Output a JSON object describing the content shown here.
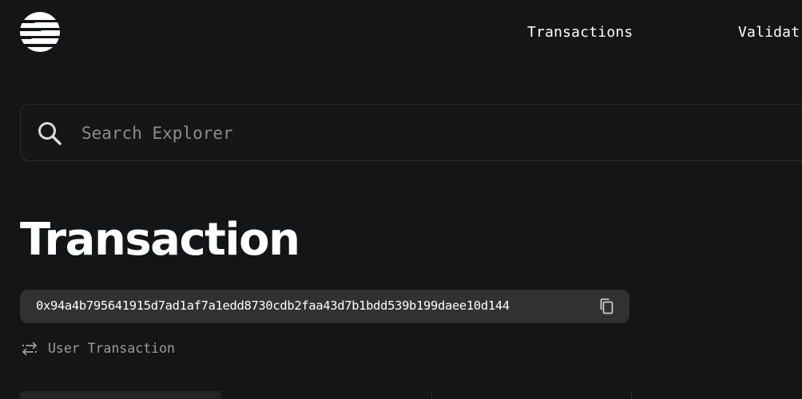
{
  "header": {
    "logo_icon": "aptos-logo-icon",
    "nav": {
      "transactions_label": "Transactions",
      "validators_label": "Validat"
    }
  },
  "search": {
    "icon": "search-icon",
    "placeholder": "Search Explorer",
    "value": ""
  },
  "page": {
    "title": "Transaction"
  },
  "transaction": {
    "hash": "0x94a4b795641915d7ad1af7a1edd8730cdb2faa43d7b1bdd539b199daee10d144",
    "copy_icon": "copy-icon",
    "type_icon": "swap-arrows-icon",
    "type_label": "User Transaction"
  },
  "colors": {
    "background": "#131516",
    "pill": "#2f3133",
    "muted_text": "#9a9d9f"
  }
}
